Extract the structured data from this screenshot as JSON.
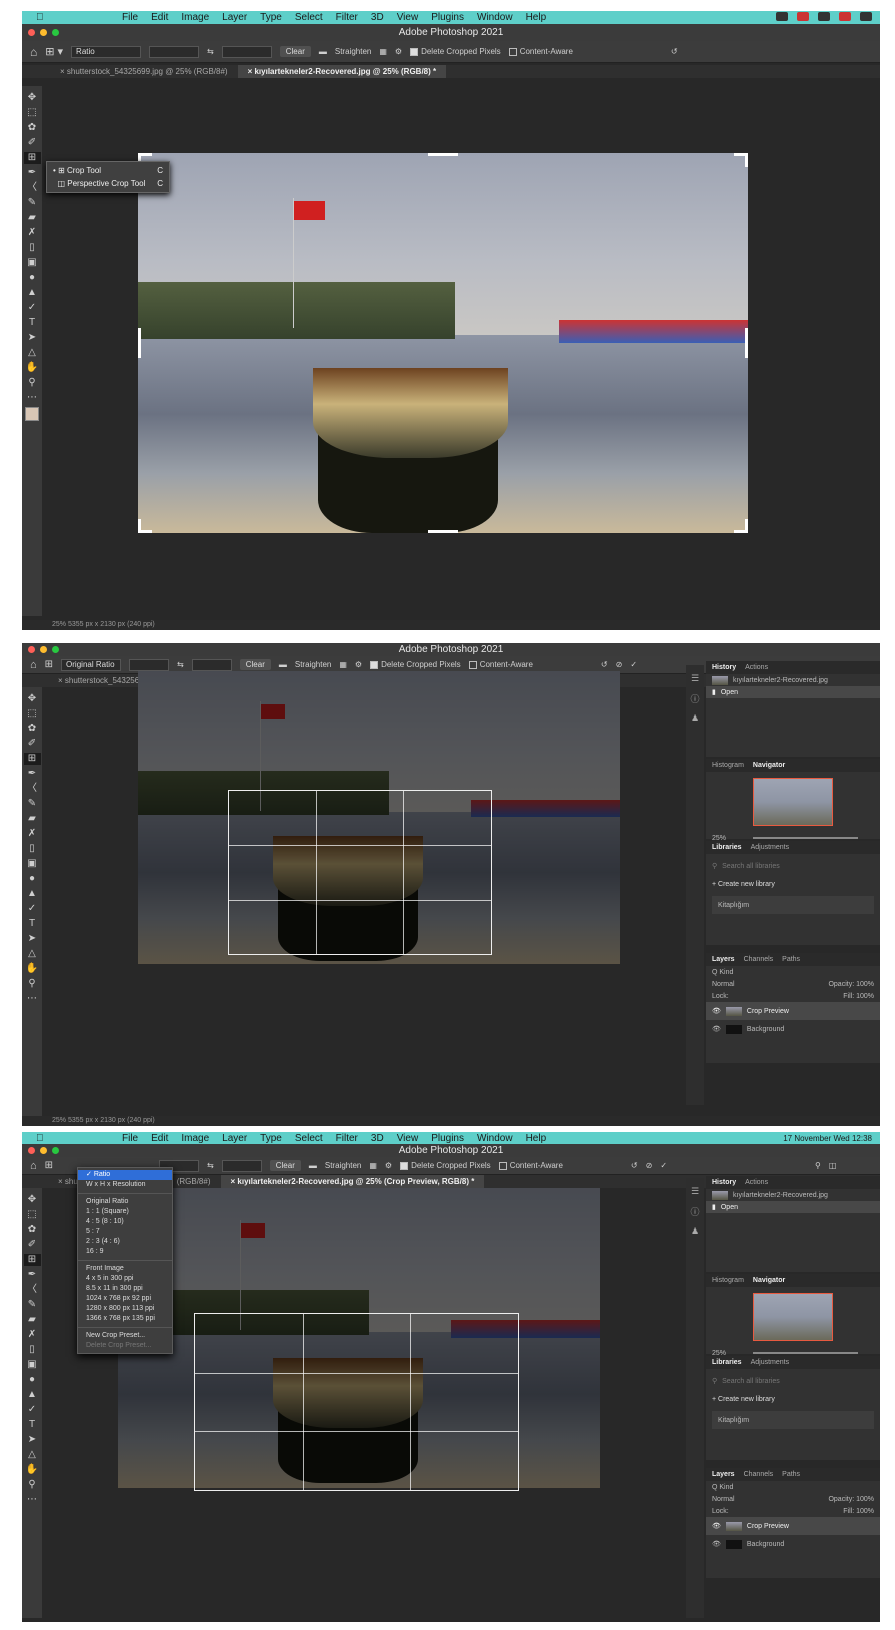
{
  "mac_menu": {
    "items": [
      "File",
      "Edit",
      "Image",
      "Layer",
      "Type",
      "Select",
      "Filter",
      "3D",
      "View",
      "Plugins",
      "Window",
      "Help"
    ],
    "clock": "17 November Wed 12:38"
  },
  "app": {
    "title": "Adobe Photoshop 2021"
  },
  "options_bar": {
    "ratio_label": "Ratio",
    "original_ratio_label": "Original Ratio",
    "clear_label": "Clear",
    "straighten_label": "Straighten",
    "delete_cropped_label": "Delete Cropped Pixels",
    "content_aware_label": "Content-Aware"
  },
  "tabs": {
    "tab1": "shutterstock_54325699.jpg @ 25% (RGB/8#)",
    "tab2_shot1": "kıyılartekneler2-Recovered.jpg @ 25% (RGB/8) *",
    "tab2_shot2": "kıyılartekneler2-Recovered.jpg @ 25% (Crop Preview, RGB/8) *",
    "tab1_short": "shutte",
    "tab1_tail": "(RGB/8#)"
  },
  "crop_flyout": {
    "items": [
      {
        "label": "Crop Tool",
        "key": "C"
      },
      {
        "label": "Perspective Crop Tool",
        "key": "C"
      }
    ]
  },
  "ratio_menu": {
    "items": [
      {
        "label": "Ratio",
        "type": "selected"
      },
      {
        "label": "W x H x Resolution",
        "type": "item"
      },
      {
        "label": "",
        "type": "sep"
      },
      {
        "label": "Original Ratio",
        "type": "item"
      },
      {
        "label": "1 : 1 (Square)",
        "type": "item"
      },
      {
        "label": "4 : 5 (8 : 10)",
        "type": "item"
      },
      {
        "label": "5 : 7",
        "type": "item"
      },
      {
        "label": "2 : 3 (4 : 6)",
        "type": "item"
      },
      {
        "label": "16 : 9",
        "type": "item"
      },
      {
        "label": "",
        "type": "sep"
      },
      {
        "label": "Front Image",
        "type": "item"
      },
      {
        "label": "4 x 5 in 300 ppi",
        "type": "item"
      },
      {
        "label": "8.5 x 11 in 300 ppi",
        "type": "item"
      },
      {
        "label": "1024 x 768 px 92 ppi",
        "type": "item"
      },
      {
        "label": "1280 x 800 px 113 ppi",
        "type": "item"
      },
      {
        "label": "1366 x 768 px 135 ppi",
        "type": "item"
      },
      {
        "label": "",
        "type": "sep"
      },
      {
        "label": "New Crop Preset...",
        "type": "item"
      },
      {
        "label": "Delete Crop Preset...",
        "type": "disabled"
      }
    ]
  },
  "panels": {
    "history_tab": "History",
    "actions_tab": "Actions",
    "history_file": "kıyılartekneler2-Recovered.jpg",
    "history_open": "Open",
    "histogram_tab": "Histogram",
    "navigator_tab": "Navigator",
    "zoom": "25%",
    "libraries_tab": "Libraries",
    "adjustments_tab": "Adjustments",
    "search_placeholder": "Search all libraries",
    "create_library": "+ Create new library",
    "library_name": "Kitaplığım",
    "layers_tab": "Layers",
    "channels_tab": "Channels",
    "paths_tab": "Paths",
    "kind": "Q Kind",
    "blend_mode": "Normal",
    "opacity": "Opacity: 100%",
    "lock": "Lock:",
    "fill": "Fill: 100%",
    "layer1": "Crop Preview",
    "layer2": "Background"
  },
  "status": {
    "shot1": "25%     5355 px x 2130 px (240 ppi)",
    "shot2": "25%     5355 px x 2130 px (240 ppi)"
  },
  "toolbar_icons": [
    "move-icon",
    "marquee-icon",
    "lasso-icon",
    "quick-select-icon",
    "crop-icon",
    "eyedropper-icon",
    "healing-icon",
    "brush-icon",
    "stamp-icon",
    "history-brush-icon",
    "eraser-icon",
    "gradient-icon",
    "blur-icon",
    "dodge-icon",
    "pen-icon",
    "type-icon",
    "path-select-icon",
    "shape-icon",
    "hand-icon",
    "zoom-icon",
    "more-icon"
  ]
}
